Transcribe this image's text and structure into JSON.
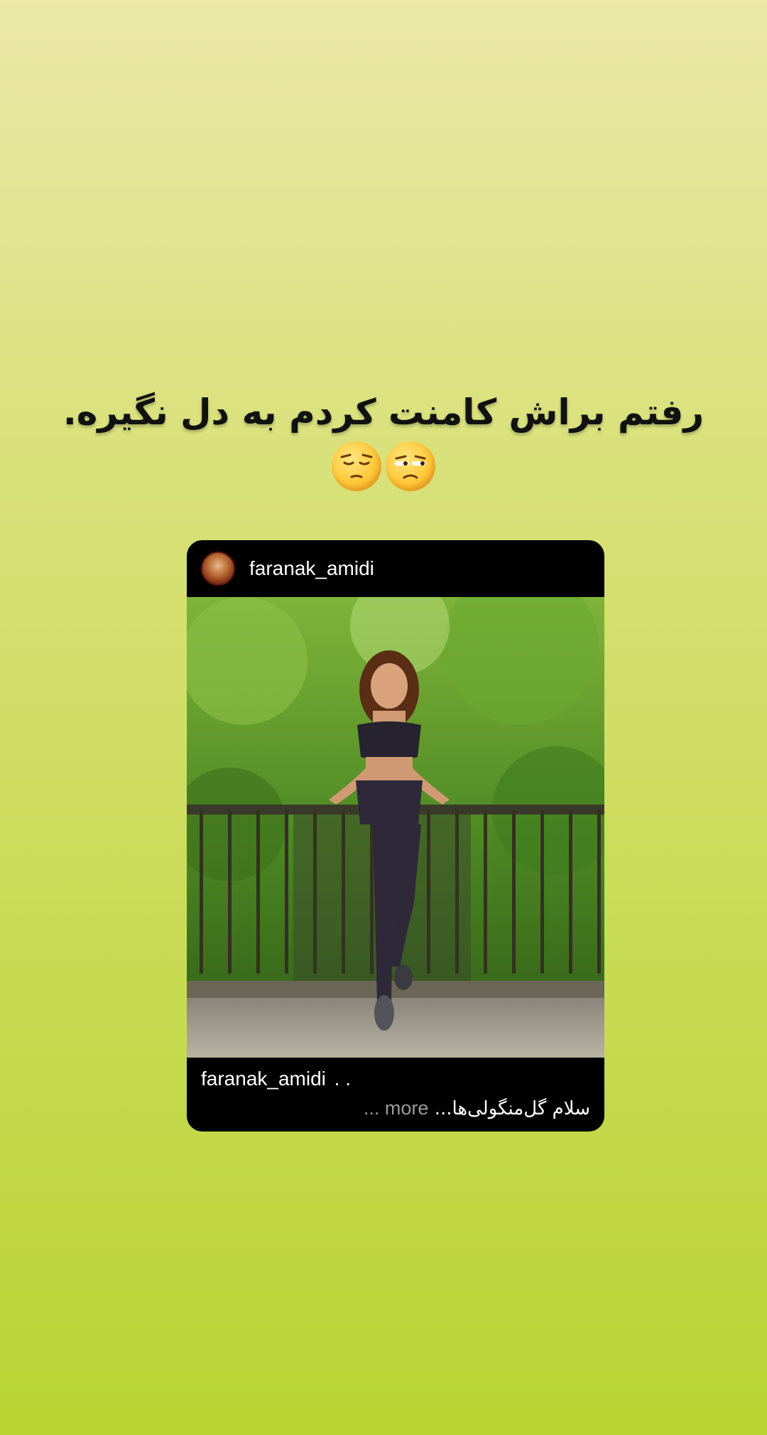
{
  "story": {
    "caption": "رفتم براش کامنت کردم به دل نگیره.",
    "emojis": [
      "unamused-face-emoji",
      "pensive-face-emoji"
    ]
  },
  "post": {
    "username": "faranak_amidi",
    "footer_username": "faranak_amidi",
    "footer_dots": ". .",
    "caption_text": "سلام گل‌منگولی‌ها...",
    "more_label": "... more"
  },
  "colors": {
    "background_top": "#ebe8a8",
    "background_bottom": "#b9d433",
    "card": "#000000"
  }
}
